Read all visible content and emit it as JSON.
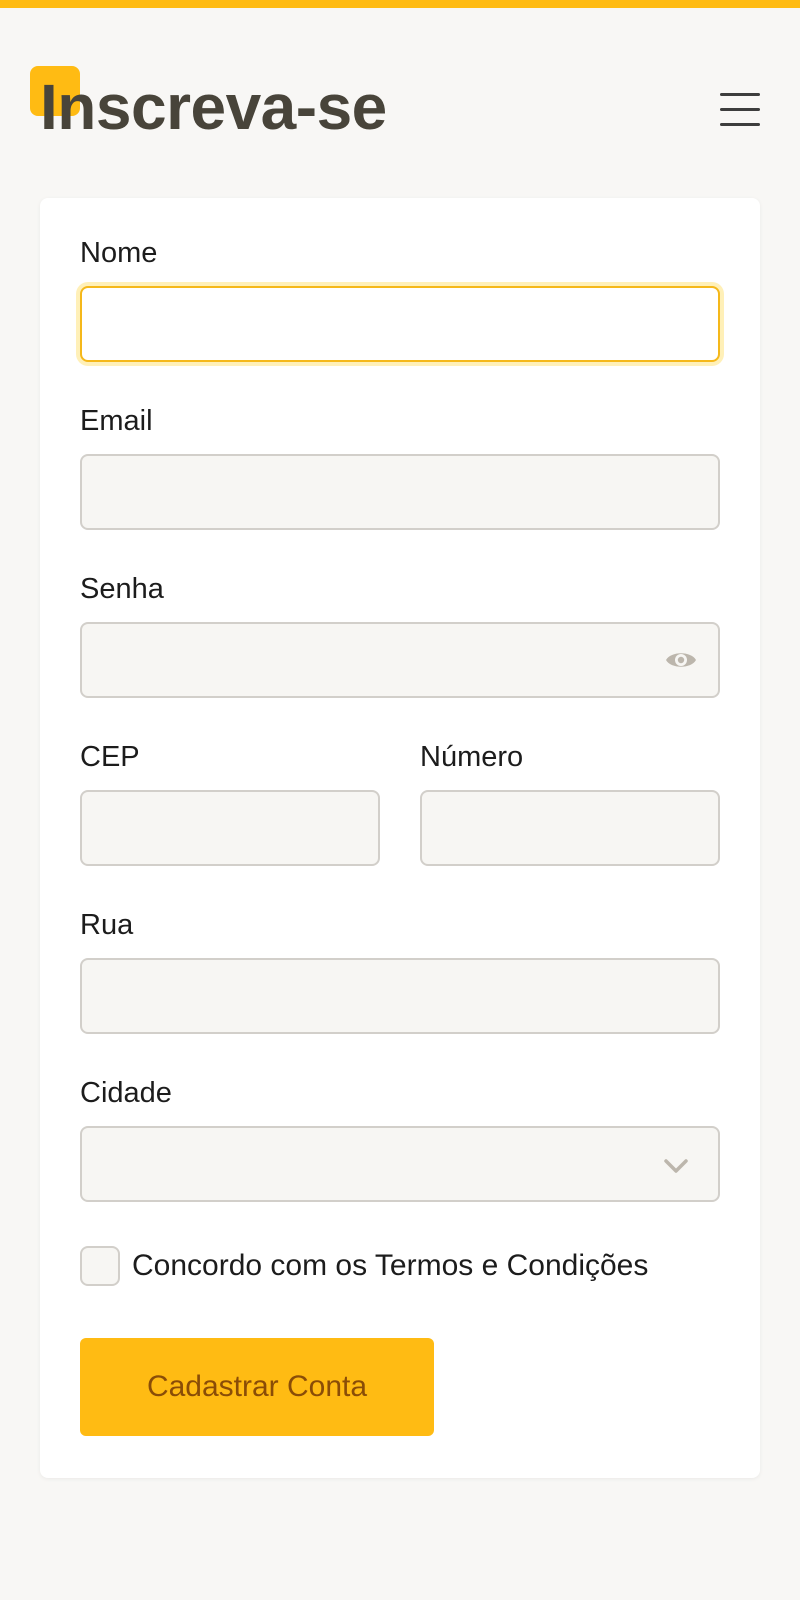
{
  "header": {
    "title": "Inscreva-se",
    "menu_icon": "hamburger-menu-icon"
  },
  "colors": {
    "accent": "#ffbb13",
    "title_text": "#48443a",
    "button_text": "#8a4d07",
    "focus_border": "#f5b81a",
    "page_background": "#f8f7f5"
  },
  "form": {
    "fields": {
      "nome": {
        "label": "Nome",
        "value": ""
      },
      "email": {
        "label": "Email",
        "value": ""
      },
      "senha": {
        "label": "Senha",
        "value": "",
        "icon": "eye-icon"
      },
      "cep": {
        "label": "CEP",
        "value": ""
      },
      "numero": {
        "label": "Número",
        "value": ""
      },
      "rua": {
        "label": "Rua",
        "value": ""
      },
      "cidade": {
        "label": "Cidade",
        "value": "",
        "icon": "chevron-down-icon"
      }
    },
    "terms_label": "Concordo com os Termos e Condições",
    "terms_checked": false,
    "submit_label": "Cadastrar Conta"
  }
}
